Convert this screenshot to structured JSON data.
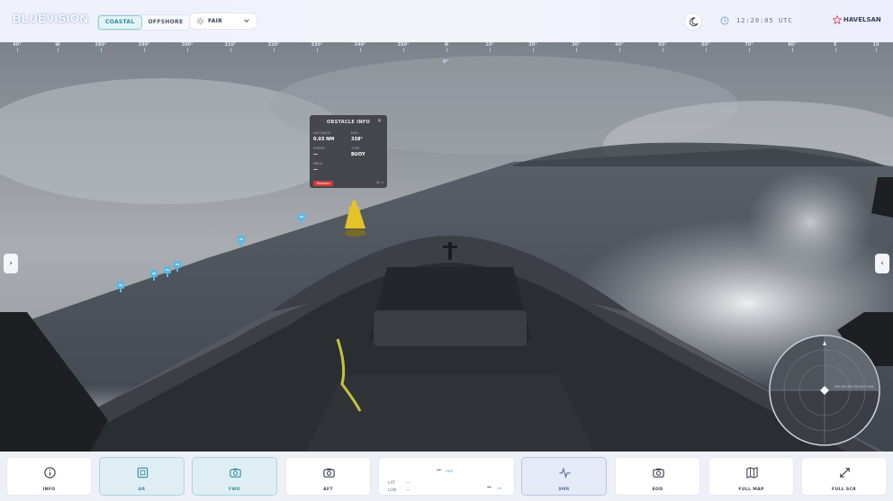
{
  "app": {
    "logo": "BLUEVISION",
    "modes": [
      {
        "label": "COASTAL",
        "active": true
      },
      {
        "label": "OFFSHORE",
        "active": false
      }
    ],
    "weather": {
      "label": "FAIR",
      "icon": "sun-icon"
    },
    "time": "12:20:05 UTC",
    "brand": "HAVELSAN"
  },
  "compass": {
    "ticks": [
      "40°",
      "W",
      "280°",
      "290°",
      "300°",
      "310°",
      "320°",
      "330°",
      "340°",
      "350°",
      "N",
      "10°",
      "20°",
      "30°",
      "40°",
      "50°",
      "60°",
      "70°",
      "80°",
      "E",
      "10"
    ],
    "heading": "0°"
  },
  "markers": [
    "19",
    "20",
    "21",
    "22",
    "23",
    "24"
  ],
  "obstacle": {
    "title": "OBSTACLE INFO",
    "close": "✕",
    "fields": [
      {
        "key": "DISTANCE",
        "value": "0.03 NM"
      },
      {
        "key": "BRG",
        "value": "338°"
      },
      {
        "key": "SPEED",
        "value": "—"
      },
      {
        "key": "TYPE",
        "value": "BUOY"
      },
      {
        "key": "MMSI",
        "value": "—"
      }
    ],
    "badge": "Obstacle",
    "id": "ID: 2"
  },
  "radar": {
    "ranges": [
      "300",
      "400",
      "600",
      "700",
      "800",
      "1000"
    ]
  },
  "bottom": {
    "buttons": [
      {
        "label": "INFO",
        "icon": "info-icon",
        "state": "normal"
      },
      {
        "label": "AR",
        "icon": "ar-icon",
        "state": "active"
      },
      {
        "label": "FWD",
        "icon": "camera-icon",
        "state": "active"
      },
      {
        "label": "AFT",
        "icon": "camera-icon",
        "state": "normal"
      },
      {
        "label": "SMR",
        "icon": "pulse-icon",
        "state": "active2"
      },
      {
        "label": "EOD",
        "icon": "camera-icon",
        "state": "normal"
      },
      {
        "label": "FULL MAP",
        "icon": "map-icon",
        "state": "normal"
      },
      {
        "label": "FULL SCR",
        "icon": "expand-icon",
        "state": "normal"
      }
    ],
    "nav": {
      "hdg_val": "—",
      "hdg_unit": "HDG",
      "lat_label": "LAT",
      "lat_val": "—",
      "lon_label": "LON",
      "lon_val": "—",
      "spd_val": "—",
      "spd_unit": "kn"
    }
  },
  "colors": {
    "accent": "#3b8ea5",
    "marker": "#5ab8df",
    "badge": "#cf3b3b"
  }
}
